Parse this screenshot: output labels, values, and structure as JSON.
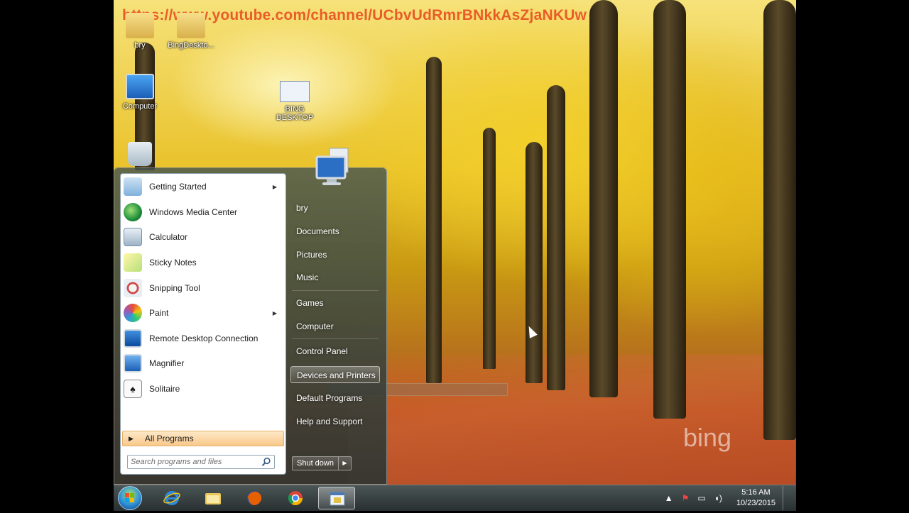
{
  "watermark": "https://www.youtube.com/channel/UCbvUdRmrBNkkAsZjaNKUw",
  "desktop_icons": [
    {
      "label": "bry"
    },
    {
      "label": "BingDeskto..."
    },
    {
      "label": "Computer"
    },
    {
      "label": "BING DESKTOP"
    }
  ],
  "start_menu": {
    "programs": [
      {
        "label": "Getting Started",
        "has_submenu": true
      },
      {
        "label": "Windows Media Center"
      },
      {
        "label": "Calculator"
      },
      {
        "label": "Sticky Notes"
      },
      {
        "label": "Snipping Tool"
      },
      {
        "label": "Paint",
        "has_submenu": true
      },
      {
        "label": "Remote Desktop Connection"
      },
      {
        "label": "Magnifier"
      },
      {
        "label": "Solitaire"
      }
    ],
    "all_programs": "All Programs",
    "search_placeholder": "Search programs and files",
    "right_items": [
      {
        "label": "bry"
      },
      {
        "label": "Documents"
      },
      {
        "label": "Pictures"
      },
      {
        "label": "Music"
      },
      {
        "label": "Games"
      },
      {
        "label": "Computer"
      },
      {
        "label": "Control Panel"
      },
      {
        "label": "Devices and Printers",
        "highlighted": true
      },
      {
        "label": "Default Programs"
      },
      {
        "label": "Help and Support"
      }
    ],
    "shutdown": "Shut down"
  },
  "bing_logo": "bing",
  "taskbar": {
    "time": "5:16 AM",
    "date": "10/23/2015"
  },
  "colors": {
    "accent": "#e8461d",
    "highlight": "#f9c88a"
  }
}
